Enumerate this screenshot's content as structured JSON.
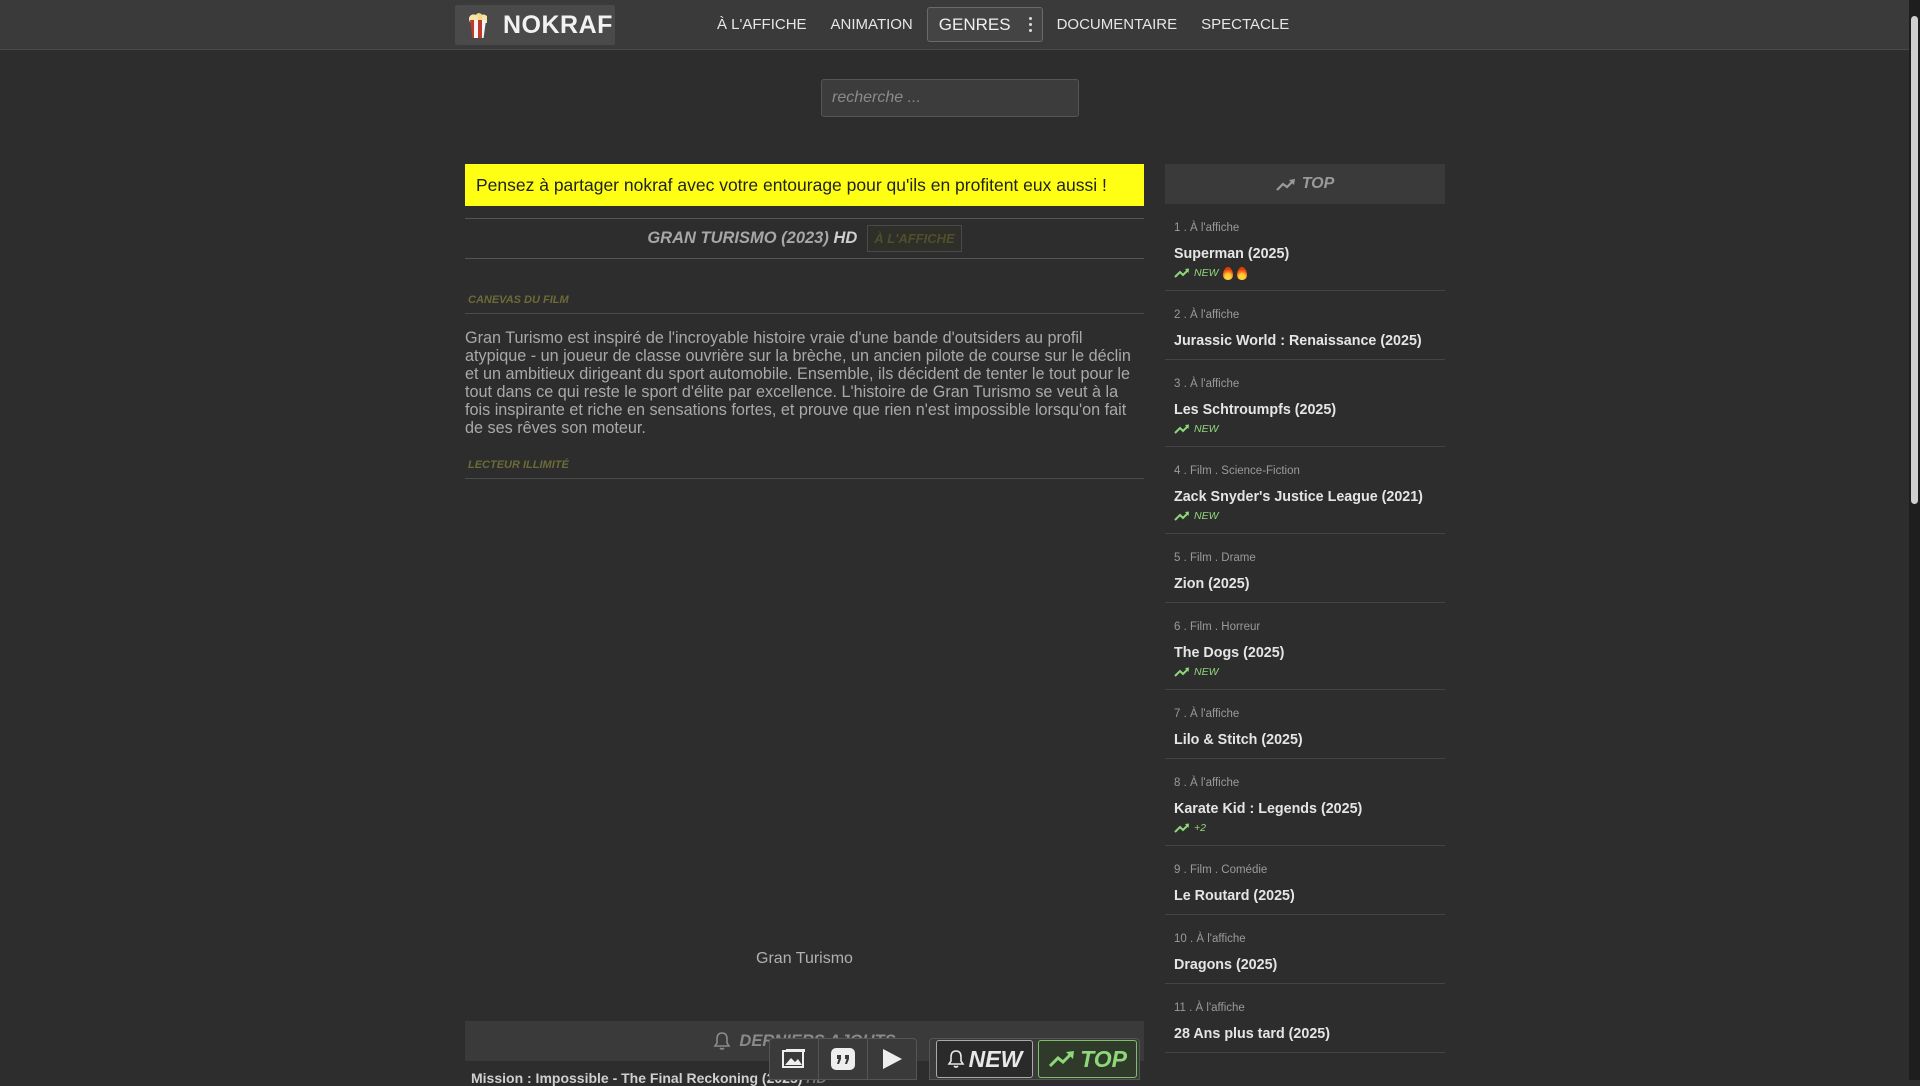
{
  "site": {
    "brand": "NOKRAF"
  },
  "nav": {
    "items": [
      "À L'AFFICHE",
      "ANIMATION"
    ],
    "genres": "GENRES",
    "items_after": [
      "DOCUMENTAIRE",
      "SPECTACLE"
    ]
  },
  "search": {
    "placeholder": "recherche ..."
  },
  "banner": "Pensez à partager nokraf avec votre entourage pour qu'ils en profitent eux aussi !",
  "movie": {
    "title": "GRAN TURISMO (2023)",
    "quality": "HD",
    "badge": "À L'AFFICHE",
    "synopsis_label": "CANEVAS DU FILM",
    "synopsis": "Gran Turismo est inspiré de l'incroyable histoire vraie d'une bande d'outsiders au profil atypique - un joueur de classe ouvrière sur la brèche, un ancien pilote de course sur le déclin et un ambitieux dirigeant du sport automobile. Ensemble, ils décident de tenter le tout pour le tout dans ce qui reste le sport d'élite par excellence. L'histoire de Gran Turismo se veut à la fois inspirante et riche en sensations fortes, et prouve que rien n'est impossible lorsqu'on fait de ses rêves son moteur.",
    "player_label": "LECTEUR ILLIMITÉ",
    "player_caption": "Gran Turismo"
  },
  "latest": {
    "label": "DERNIERS AJOUTS",
    "first_title": "Mission : Impossible - The Final Reckoning (2025)",
    "first_quality": "HD"
  },
  "buttons": {
    "new": "NEW",
    "top": "TOP"
  },
  "top": {
    "label": "TOP",
    "items": [
      {
        "meta": "1 . À l'affiche",
        "name": "Superman (2025)",
        "tag": "NEW",
        "fire": 2
      },
      {
        "meta": "2 . À l'affiche",
        "name": "Jurassic World : Renaissance (2025)",
        "tag": "",
        "fire": 0
      },
      {
        "meta": "3 . À l'affiche",
        "name": "Les Schtroumpfs (2025)",
        "tag": "NEW",
        "fire": 0
      },
      {
        "meta": "4 . Film . Science-Fiction",
        "name": "Zack Snyder's Justice League (2021)",
        "tag": "NEW",
        "fire": 0
      },
      {
        "meta": "5 . Film . Drame",
        "name": "Zion (2025)",
        "tag": "",
        "fire": 0
      },
      {
        "meta": "6 . Film . Horreur",
        "name": "The Dogs (2025)",
        "tag": "NEW",
        "fire": 0
      },
      {
        "meta": "7 . À l'affiche",
        "name": "Lilo & Stitch (2025)",
        "tag": "",
        "fire": 0
      },
      {
        "meta": "8 . À l'affiche",
        "name": "Karate Kid : Legends (2025)",
        "tag": "+2",
        "fire": 0
      },
      {
        "meta": "9 . Film . Comédie",
        "name": "Le Routard (2025)",
        "tag": "",
        "fire": 0
      },
      {
        "meta": "10 . À l'affiche",
        "name": "Dragons (2025)",
        "tag": "",
        "fire": 0
      },
      {
        "meta": "11 . À l'affiche",
        "name": "28 Ans plus tard (2025)",
        "tag": "",
        "fire": 0
      }
    ]
  },
  "colors": {
    "accent_green": "#8fd87a",
    "banner_yellow": "#ffff14",
    "background": "#2d2d2d"
  }
}
